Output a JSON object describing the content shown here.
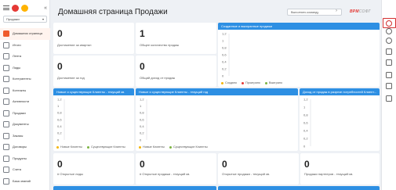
{
  "sidebar": {
    "workspace": "Продажи",
    "collapse_icon": "«",
    "items": [
      {
        "label": "Домашняя страница",
        "icon": "home-icon",
        "active": true
      },
      {
        "label": "Итоги",
        "icon": "summary-icon"
      },
      {
        "label": "Лента",
        "icon": "feed-icon"
      },
      {
        "label": "Лиды",
        "icon": "leads-icon"
      },
      {
        "label": "Контрагенты",
        "icon": "accounts-icon"
      },
      {
        "label": "Контакты",
        "icon": "contacts-icon"
      },
      {
        "label": "Активности",
        "icon": "activities-icon"
      },
      {
        "label": "Продажи",
        "icon": "sales-icon"
      },
      {
        "label": "Документы",
        "icon": "documents-icon"
      },
      {
        "label": "Заказы",
        "icon": "orders-icon"
      },
      {
        "label": "Договоры",
        "icon": "contracts-icon"
      },
      {
        "label": "Продукты",
        "icon": "products-icon"
      },
      {
        "label": "Счета",
        "icon": "invoices-icon"
      },
      {
        "label": "База знаний",
        "icon": "knowledge-icon"
      }
    ]
  },
  "header": {
    "title": "Домашняя страница Продажи",
    "command_placeholder": "Выполнить команду",
    "go_icon": "›",
    "brand": "ВРМ",
    "brand_suffix": "СОФТ"
  },
  "kpis_top": [
    {
      "value": "0",
      "caption": "Достижение за квартал"
    },
    {
      "value": "1",
      "caption": "Общее количество продаж"
    },
    {
      "value": "0",
      "caption": "Достижение за год"
    },
    {
      "value": "0",
      "caption": "Общий доход от продаж"
    }
  ],
  "kpis_bottom": [
    {
      "value": "0",
      "caption": "# Открытые лиды"
    },
    {
      "value": "0",
      "caption": "# Открытые продажи - текущий кв."
    },
    {
      "value": "0",
      "caption": "Открытые продажи - текущий кв."
    },
    {
      "value": "0",
      "caption": "Продажи партнеров - текущий кв."
    }
  ],
  "charts": [
    {
      "title": "Созданные и выигранные продажи",
      "legend": [
        {
          "name": "Создано",
          "color": "#f5b400"
        },
        {
          "name": "Проиграно",
          "color": "#e53935"
        },
        {
          "name": "Выиграно",
          "color": "#7cb342"
        }
      ]
    },
    {
      "title": "Новые и существующие Клиенты - текущий кв.",
      "legend": [
        {
          "name": "Новые Клиенты",
          "color": "#f5b400"
        },
        {
          "name": "Существующие Клиенты",
          "color": "#7cb342"
        }
      ]
    },
    {
      "title": "Новые и существующие Клиенты - текущий год",
      "legend": [
        {
          "name": "Новые Клиенты",
          "color": "#f5b400"
        },
        {
          "name": "Существующие Клиенты",
          "color": "#7cb342"
        }
      ]
    },
    {
      "title": "Доход от продаж в разрезе потребностей Клиент...",
      "legend": []
    }
  ],
  "chart_data": [
    {
      "type": "bar",
      "title": "Созданные и выигранные продажи",
      "ylim": [
        0,
        1.2
      ],
      "yticks": [
        "1,2",
        "1",
        "0,8",
        "0,6",
        "0,4",
        "0,2",
        "0"
      ],
      "series": [
        {
          "name": "Создано",
          "values": []
        },
        {
          "name": "Проиграно",
          "values": []
        },
        {
          "name": "Выиграно",
          "values": []
        }
      ]
    },
    {
      "type": "bar",
      "title": "Новые и существующие Клиенты - текущий кв.",
      "ylim": [
        0,
        1.2
      ],
      "yticks": [
        "1,2",
        "1",
        "0,8",
        "0,6",
        "0,4",
        "0,2",
        "0"
      ],
      "series": [
        {
          "name": "Новые Клиенты",
          "values": []
        },
        {
          "name": "Существующие Клиенты",
          "values": []
        }
      ]
    },
    {
      "type": "bar",
      "title": "Новые и существующие Клиенты - текущий год",
      "ylim": [
        0,
        1.2
      ],
      "yticks": [
        "1,2",
        "1",
        "0,8",
        "0,6",
        "0,4",
        "0,2",
        "0"
      ],
      "series": [
        {
          "name": "Новые Клиенты",
          "values": []
        },
        {
          "name": "Существующие Клиенты",
          "values": []
        }
      ]
    },
    {
      "type": "bar",
      "title": "Доход от продаж в разрезе потребностей Клиент...",
      "ylim": [
        0,
        1.2
      ],
      "yticks": [
        "1,2",
        "1",
        "0,8",
        "0,6",
        "0,4",
        "0,2",
        "0"
      ],
      "series": []
    }
  ],
  "rail": {
    "icons": [
      "globe-icon",
      "settings-icon",
      "help-icon",
      "chat-icon",
      "messages-icon",
      "feedback-icon",
      "notifications-icon",
      "tasks-icon"
    ]
  }
}
